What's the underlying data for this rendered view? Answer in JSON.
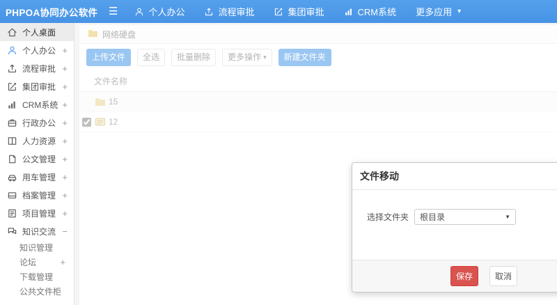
{
  "colors": {
    "topbar_blue": "#4a98e8",
    "primary_button_blue": "#4898e8",
    "save_button_red": "#d9534f",
    "folder_yellow": "#e9c66a"
  },
  "topbar": {
    "logo": "PHPOA协同办公软件",
    "nav": [
      {
        "label": "个人办公",
        "icon": "user-icon"
      },
      {
        "label": "流程审批",
        "icon": "process-approval-icon"
      },
      {
        "label": "集团审批",
        "icon": "group-approval-icon"
      },
      {
        "label": "CRM系统",
        "icon": "chart-icon"
      },
      {
        "label": "更多应用",
        "icon": "caret-down-icon"
      }
    ],
    "more_caret": "▾"
  },
  "sidebar": {
    "items": [
      {
        "label": "个人桌面",
        "icon": "home-icon",
        "expand": "",
        "active": true
      },
      {
        "label": "个人办公",
        "icon": "user-icon",
        "expand": "+"
      },
      {
        "label": "流程审批",
        "icon": "process-approval-icon",
        "expand": "+"
      },
      {
        "label": "集团审批",
        "icon": "group-approval-icon",
        "expand": "+"
      },
      {
        "label": "CRM系统",
        "icon": "chart-icon",
        "expand": "+"
      },
      {
        "label": "行政办公",
        "icon": "briefcase-icon",
        "expand": "+"
      },
      {
        "label": "人力资源",
        "icon": "book-icon",
        "expand": "+"
      },
      {
        "label": "公文管理",
        "icon": "document-icon",
        "expand": "+"
      },
      {
        "label": "用车管理",
        "icon": "car-icon",
        "expand": "+"
      },
      {
        "label": "档案管理",
        "icon": "archive-icon",
        "expand": "+"
      },
      {
        "label": "项目管理",
        "icon": "project-icon",
        "expand": "+"
      },
      {
        "label": "知识交流",
        "icon": "chat-icon",
        "expand": "−"
      }
    ],
    "sub_items": [
      {
        "label": "知识管理",
        "expand": ""
      },
      {
        "label": "论坛",
        "expand": "+"
      },
      {
        "label": "下载管理",
        "expand": ""
      },
      {
        "label": "公共文件柜",
        "expand": ""
      }
    ]
  },
  "content": {
    "breadcrumb": {
      "icon": "folder-icon",
      "label": "网络硬盘"
    },
    "toolbar": {
      "upload": "上传文件",
      "select_all": "全选",
      "batch_delete": "批量删除",
      "more_actions": "更多操作",
      "more_caret": "▾",
      "new_folder": "新建文件夹"
    },
    "table": {
      "header": "文件名称",
      "rows": [
        {
          "name": "15",
          "type": "folder",
          "checked": false
        },
        {
          "name": "12",
          "type": "file",
          "checked": true
        }
      ]
    }
  },
  "modal": {
    "title": "文件移动",
    "field_label": "选择文件夹",
    "select_value": "根目录",
    "select_caret": "▼",
    "save": "保存",
    "cancel": "取消"
  }
}
